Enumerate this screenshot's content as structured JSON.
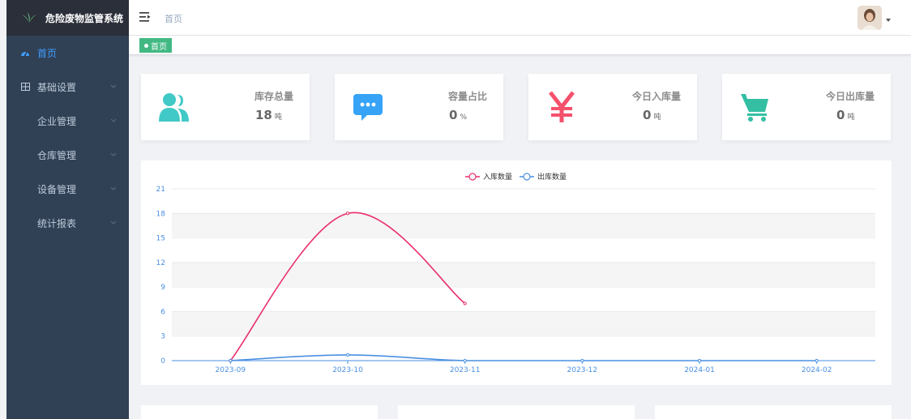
{
  "app": {
    "title": "危险废物监管系统"
  },
  "sidebar": {
    "items": [
      {
        "label": "首页",
        "icon": "dashboard-icon",
        "active": true
      },
      {
        "label": "基础设置",
        "icon": "grid-icon",
        "active": false
      },
      {
        "label": "企业管理",
        "active": false
      },
      {
        "label": "仓库管理",
        "active": false
      },
      {
        "label": "设备管理",
        "active": false
      },
      {
        "label": "统计报表",
        "active": false
      }
    ]
  },
  "header": {
    "breadcrumb": "首页"
  },
  "tags": {
    "active_tag": "首页"
  },
  "stats": [
    {
      "title": "库存总量",
      "value": "18",
      "unit": "吨",
      "icon": "people-icon",
      "color": "#40c9c6"
    },
    {
      "title": "容量占比",
      "value": "0",
      "unit": "%",
      "icon": "message-icon",
      "color": "#36a3f7"
    },
    {
      "title": "今日入库量",
      "value": "0",
      "unit": "吨",
      "icon": "yuan-icon",
      "color": "#f4516c"
    },
    {
      "title": "今日出库量",
      "value": "0",
      "unit": "吨",
      "icon": "shopping-cart-icon",
      "color": "#34bfa3"
    }
  ],
  "chart_data": {
    "type": "line",
    "categories": [
      "2023-09",
      "2023-10",
      "2023-11",
      "2023-12",
      "2024-01",
      "2024-02"
    ],
    "series": [
      {
        "name": "入库数量",
        "color": "#e9306a",
        "values": [
          0,
          18,
          7,
          null,
          null,
          null
        ]
      },
      {
        "name": "出库数量",
        "color": "#4a90e2",
        "values": [
          0,
          0.7,
          0,
          0,
          0,
          0
        ]
      }
    ],
    "yticks": [
      0,
      3,
      6,
      9,
      12,
      15,
      18,
      21
    ],
    "ylim": [
      0,
      21
    ],
    "legend_position": "top-center",
    "smooth": true,
    "grid": "horizontal-bands"
  }
}
